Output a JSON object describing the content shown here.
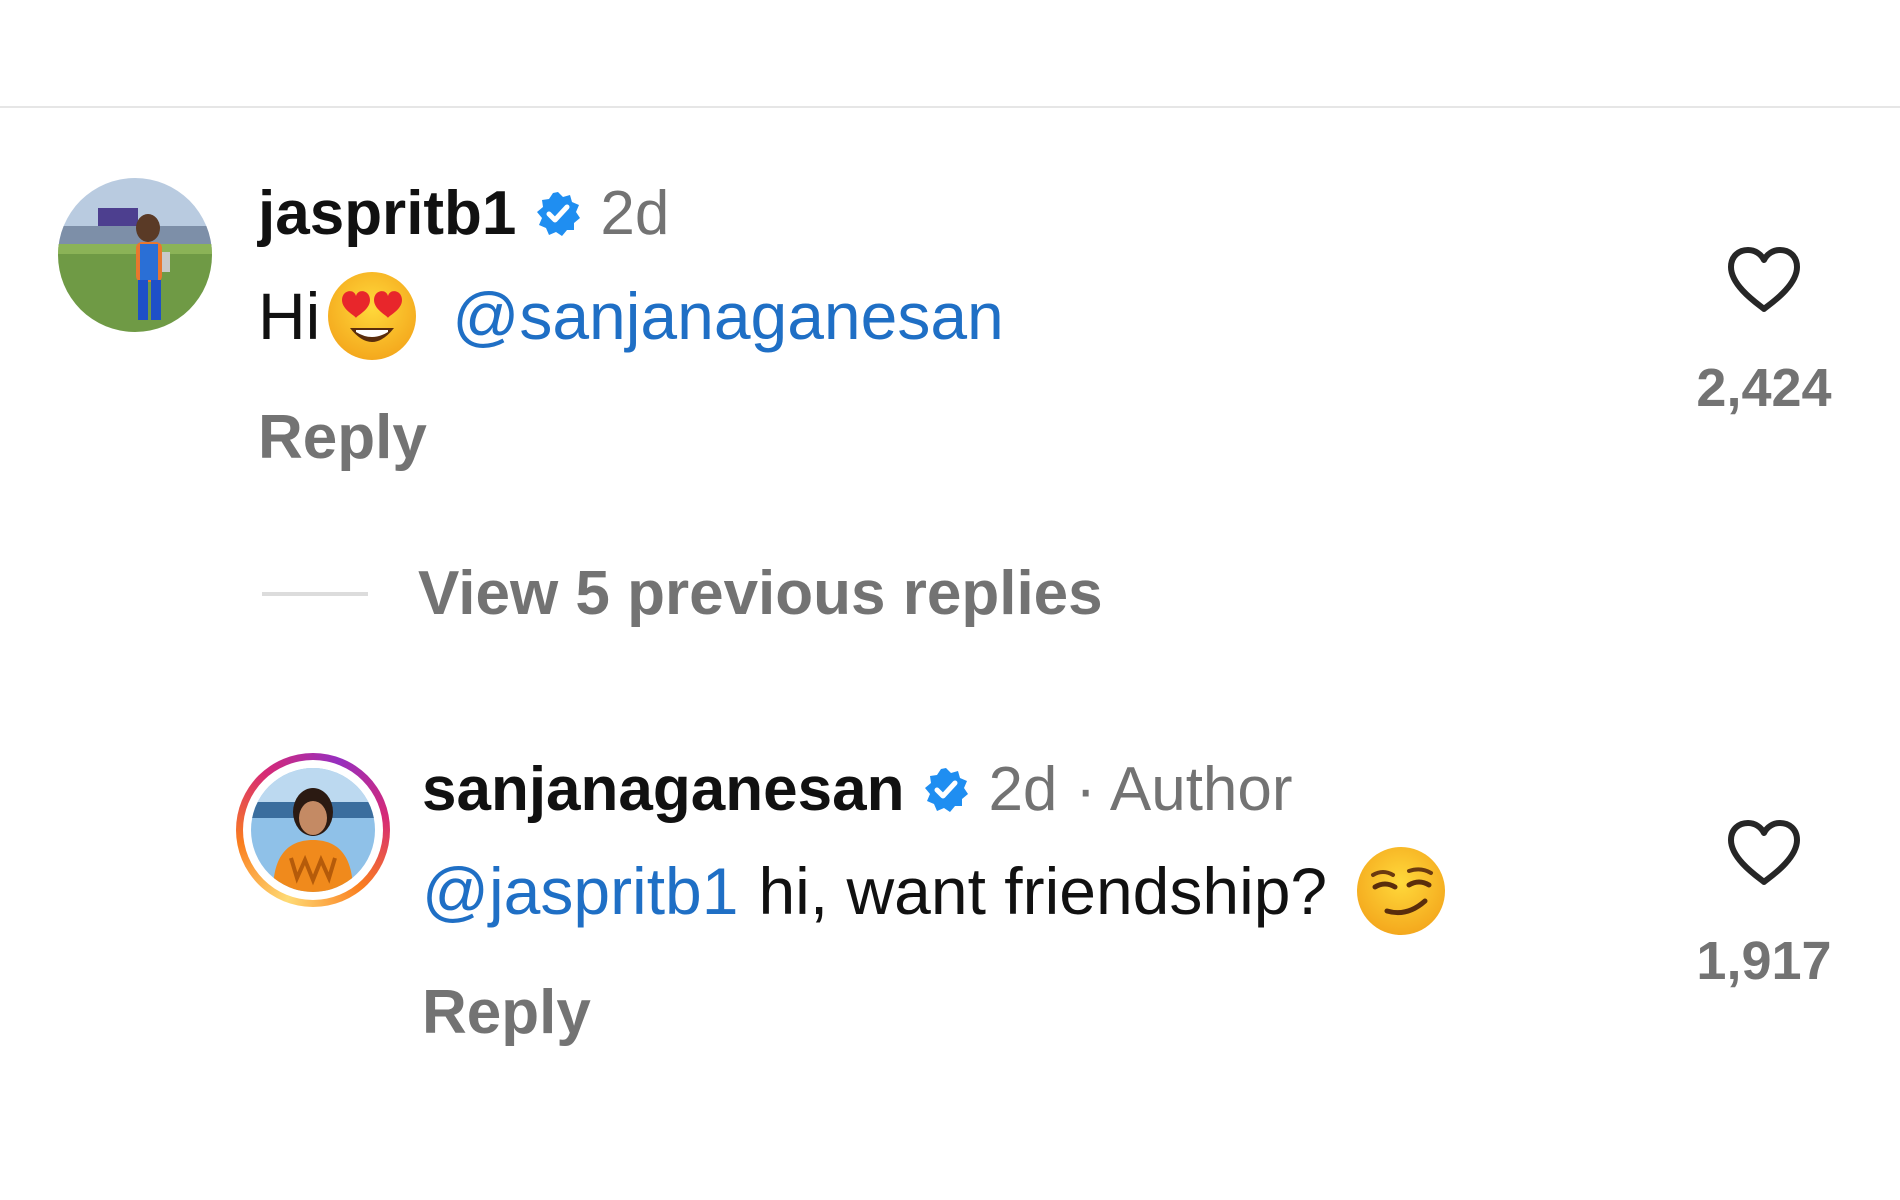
{
  "comments": [
    {
      "username": "jaspritb1",
      "time": "2d",
      "author_tag": "",
      "text_before": "Hi",
      "emoji": "heart-eyes-emoji",
      "mention": "@sanjanaganesan",
      "text_after": "",
      "reply_label": "Reply",
      "likes": "2,424",
      "verified": true
    },
    {
      "username": "sanjanaganesan",
      "time": "2d",
      "author_tag": "· Author",
      "mention": "@jaspritb1",
      "text": "hi, want friendship?",
      "emoji": "smirk-emoji",
      "reply_label": "Reply",
      "likes": "1,917",
      "verified": true
    }
  ],
  "view_replies": {
    "label": "View 5 previous replies"
  },
  "colors": {
    "mention": "#1f6fc5",
    "muted": "#737373",
    "verified": "#1f8ef1",
    "text": "#111111"
  }
}
